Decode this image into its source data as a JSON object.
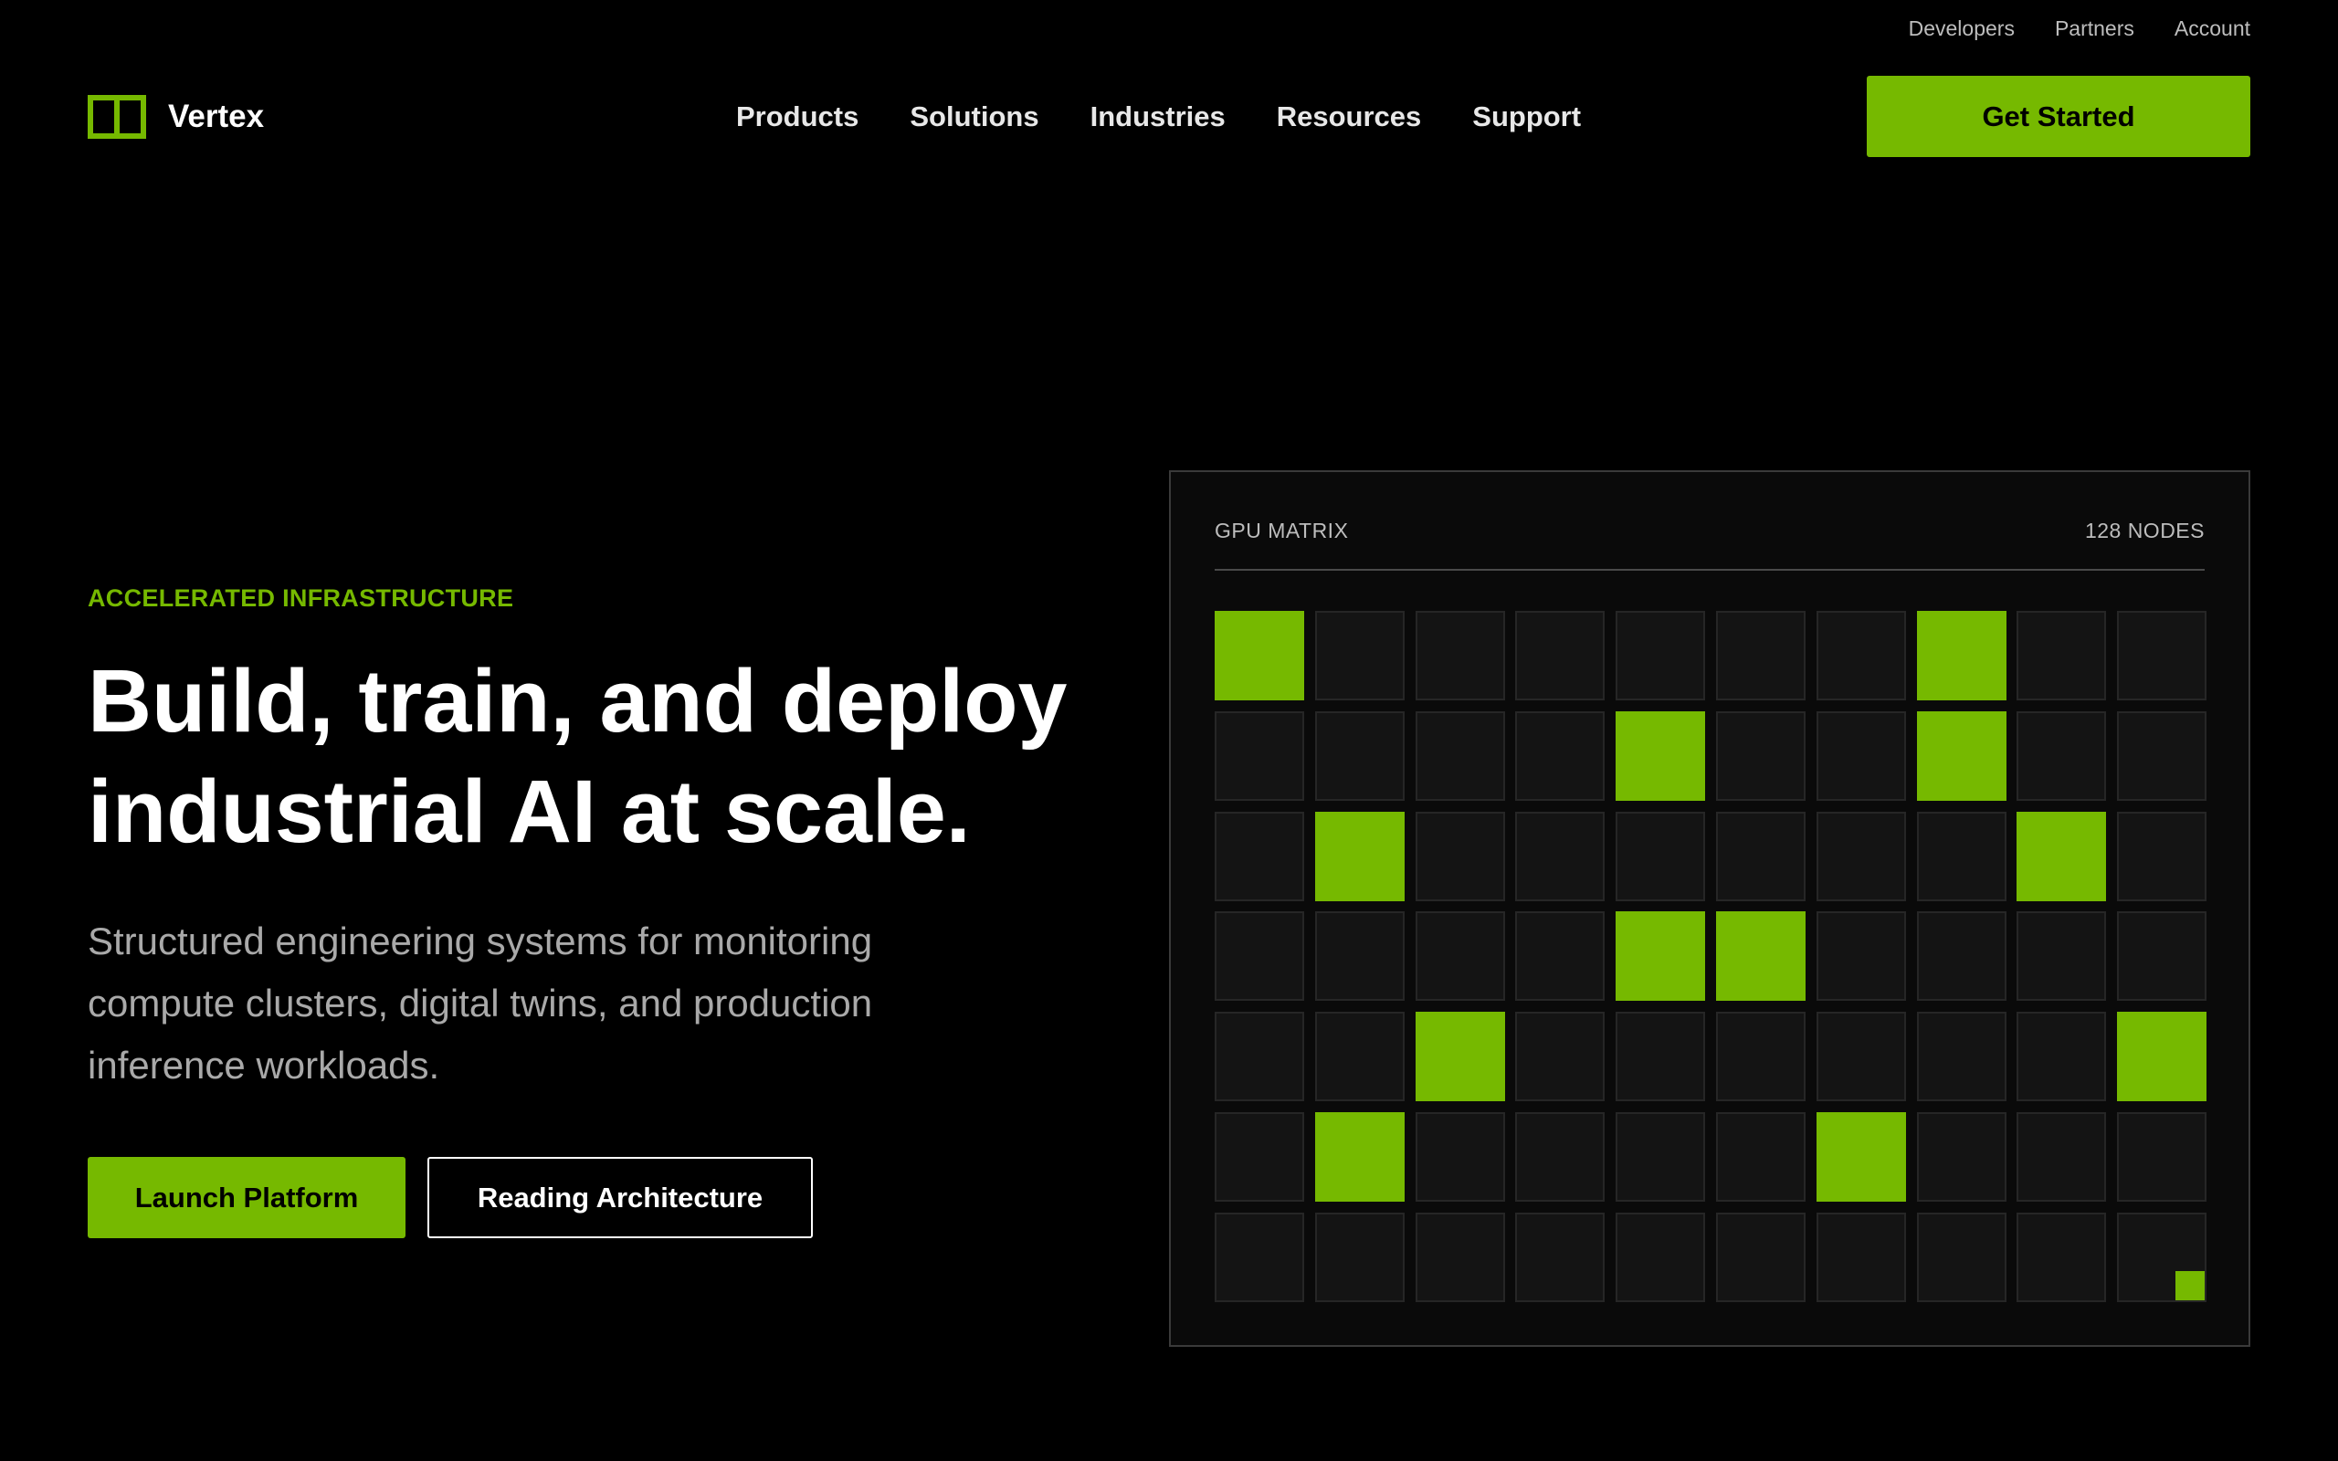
{
  "utility_nav": [
    "Developers",
    "Partners",
    "Account"
  ],
  "brand": {
    "name": "Vertex",
    "accent": "#76b900",
    "logo_icon": "split-square-logo-icon"
  },
  "main_nav": [
    "Products",
    "Solutions",
    "Industries",
    "Resources",
    "Support"
  ],
  "header_cta": "Get Started",
  "hero": {
    "eyebrow": "ACCELERATED INFRASTRUCTURE",
    "title_line1": "Build, train, and deploy",
    "title_line2": "industrial AI at scale.",
    "subtitle": "Structured engineering systems for monitoring compute clusters, digital twins, and production inference workloads.",
    "primary_button": "Launch Platform",
    "secondary_button": "Reading Architecture"
  },
  "matrix": {
    "title": "GPU MATRIX",
    "count_label": "128 NODES",
    "columns": 10,
    "rows": [
      [
        1,
        0,
        0,
        0,
        0,
        0,
        0,
        1,
        0,
        0
      ],
      [
        0,
        0,
        0,
        0,
        1,
        0,
        0,
        1,
        0,
        0
      ],
      [
        0,
        1,
        0,
        0,
        0,
        0,
        0,
        0,
        1,
        0
      ],
      [
        0,
        0,
        0,
        0,
        1,
        1,
        0,
        0,
        0,
        0
      ],
      [
        0,
        0,
        1,
        0,
        0,
        0,
        0,
        0,
        0,
        1
      ],
      [
        0,
        1,
        0,
        0,
        0,
        0,
        1,
        0,
        0,
        0
      ],
      [
        0,
        0,
        0,
        0,
        0,
        0,
        0,
        0,
        0,
        2
      ]
    ],
    "colors": {
      "active": "#76b900",
      "inactive": "#141414",
      "border": "#262626"
    }
  }
}
